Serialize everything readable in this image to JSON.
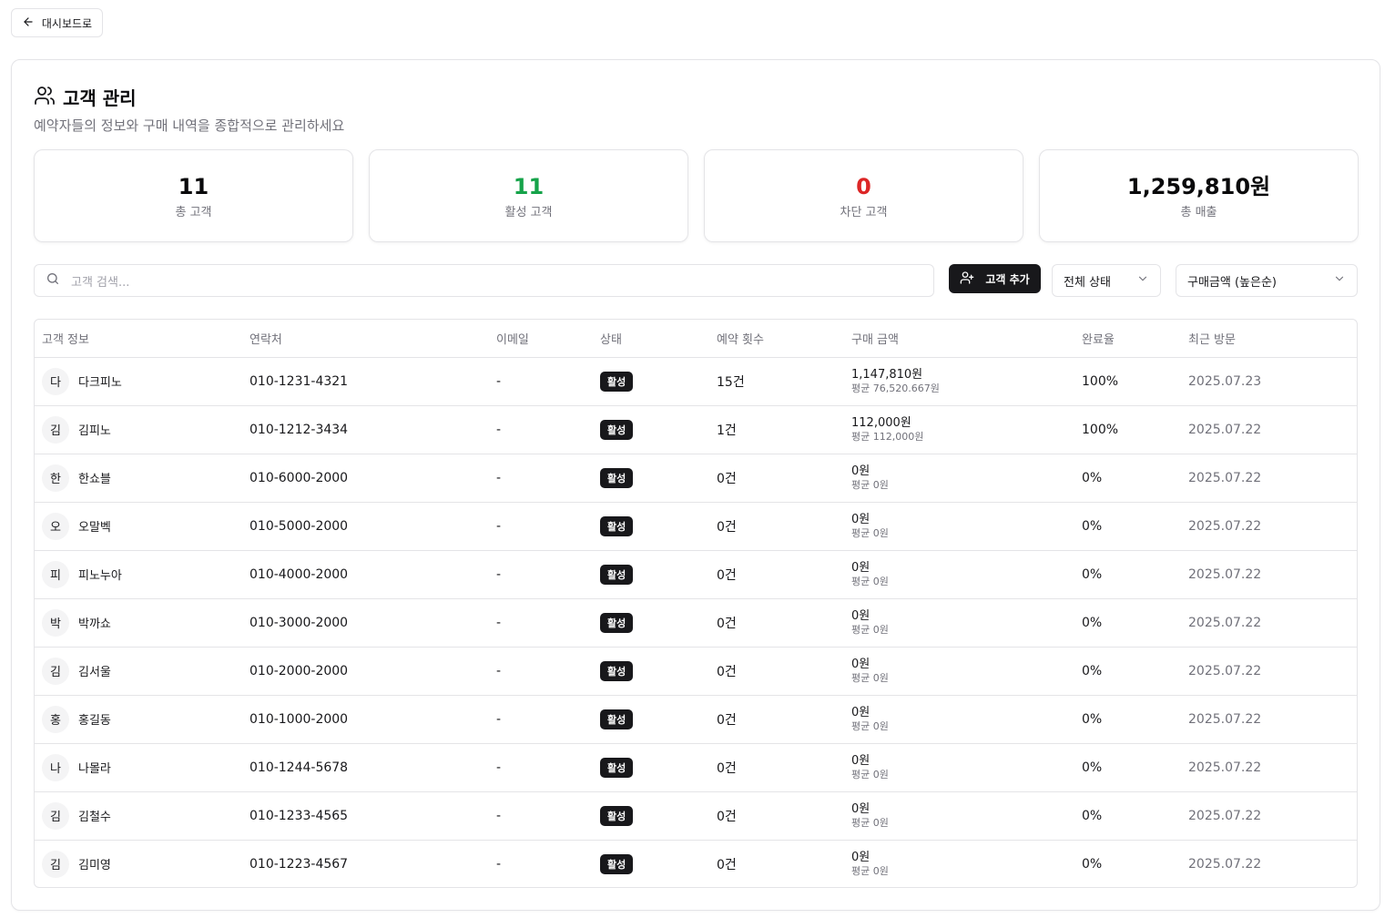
{
  "back_button": {
    "label": "대시보드로"
  },
  "page": {
    "title": "고객 관리",
    "subtitle": "예약자들의 정보와 구매 내역을 종합적으로 관리하세요"
  },
  "stats": [
    {
      "value": "11",
      "label": "총 고객",
      "color": "#09090b"
    },
    {
      "value": "11",
      "label": "활성 고객",
      "color": "#16a34a"
    },
    {
      "value": "0",
      "label": "차단 고객",
      "color": "#dc2626"
    },
    {
      "value": "1,259,810원",
      "label": "총 매출",
      "color": "#09090b"
    }
  ],
  "search": {
    "placeholder": "고객 검색..."
  },
  "toolbar": {
    "add_label": "고객 추가",
    "status_filter": "전체 상태",
    "sort": "구매금액 (높은순)"
  },
  "table": {
    "headers": [
      "고객 정보",
      "연락처",
      "이메일",
      "상태",
      "예약 횟수",
      "구매 금액",
      "완료율",
      "최근 방문"
    ],
    "rows": [
      {
        "initial": "다",
        "name": "다크피노",
        "phone": "010-1231-4321",
        "email": "-",
        "status": "활성",
        "count": "15건",
        "amount": "1,147,810원",
        "avg": "평균 76,520.667원",
        "rate": "100%",
        "visit": "2025.07.23"
      },
      {
        "initial": "김",
        "name": "김피노",
        "phone": "010-1212-3434",
        "email": "-",
        "status": "활성",
        "count": "1건",
        "amount": "112,000원",
        "avg": "평균 112,000원",
        "rate": "100%",
        "visit": "2025.07.22"
      },
      {
        "initial": "한",
        "name": "한쇼블",
        "phone": "010-6000-2000",
        "email": "-",
        "status": "활성",
        "count": "0건",
        "amount": "0원",
        "avg": "평균 0원",
        "rate": "0%",
        "visit": "2025.07.22"
      },
      {
        "initial": "오",
        "name": "오말벡",
        "phone": "010-5000-2000",
        "email": "-",
        "status": "활성",
        "count": "0건",
        "amount": "0원",
        "avg": "평균 0원",
        "rate": "0%",
        "visit": "2025.07.22"
      },
      {
        "initial": "피",
        "name": "피노누아",
        "phone": "010-4000-2000",
        "email": "-",
        "status": "활성",
        "count": "0건",
        "amount": "0원",
        "avg": "평균 0원",
        "rate": "0%",
        "visit": "2025.07.22"
      },
      {
        "initial": "박",
        "name": "박까쇼",
        "phone": "010-3000-2000",
        "email": "-",
        "status": "활성",
        "count": "0건",
        "amount": "0원",
        "avg": "평균 0원",
        "rate": "0%",
        "visit": "2025.07.22"
      },
      {
        "initial": "김",
        "name": "김서울",
        "phone": "010-2000-2000",
        "email": "-",
        "status": "활성",
        "count": "0건",
        "amount": "0원",
        "avg": "평균 0원",
        "rate": "0%",
        "visit": "2025.07.22"
      },
      {
        "initial": "홍",
        "name": "홍길동",
        "phone": "010-1000-2000",
        "email": "-",
        "status": "활성",
        "count": "0건",
        "amount": "0원",
        "avg": "평균 0원",
        "rate": "0%",
        "visit": "2025.07.22"
      },
      {
        "initial": "나",
        "name": "나몰라",
        "phone": "010-1244-5678",
        "email": "-",
        "status": "활성",
        "count": "0건",
        "amount": "0원",
        "avg": "평균 0원",
        "rate": "0%",
        "visit": "2025.07.22"
      },
      {
        "initial": "김",
        "name": "김철수",
        "phone": "010-1233-4565",
        "email": "-",
        "status": "활성",
        "count": "0건",
        "amount": "0원",
        "avg": "평균 0원",
        "rate": "0%",
        "visit": "2025.07.22"
      },
      {
        "initial": "김",
        "name": "김미영",
        "phone": "010-1223-4567",
        "email": "-",
        "status": "활성",
        "count": "0건",
        "amount": "0원",
        "avg": "평균 0원",
        "rate": "0%",
        "visit": "2025.07.22"
      }
    ]
  }
}
